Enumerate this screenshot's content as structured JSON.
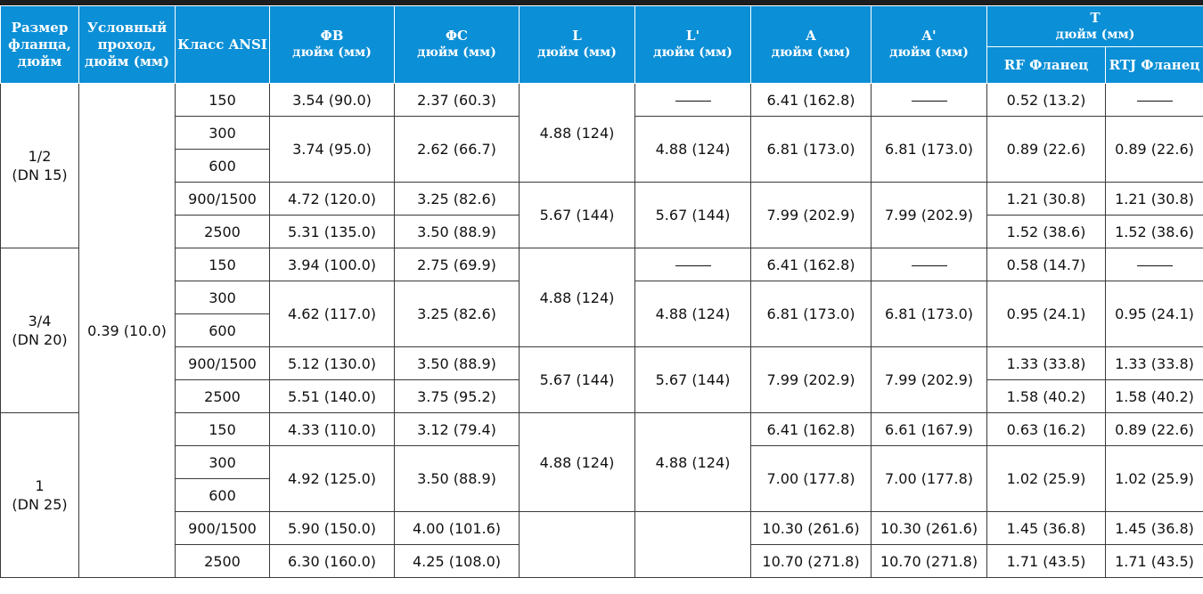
{
  "header": {
    "size": "Размер фланца, дюйм",
    "bore": "Условный проход, дюйм (мм)",
    "cls": "Класс ANSI",
    "fb": "ΦB",
    "fc": "ΦC",
    "l": "L",
    "l2": "L'",
    "a": "A",
    "a2": "A'",
    "t": "T",
    "unit": "дюйм (мм)",
    "rf": "RF Фланец",
    "rtj": "RTJ Фланец"
  },
  "dash": "—",
  "bore_value": "0.39 (10.0)",
  "groups": [
    {
      "size": "1/2",
      "dn": "(DN 15)",
      "rows": [
        {
          "cls": "150",
          "fb": "3.54 (90.0)",
          "fc": "2.37 (60.3)",
          "l2": "—",
          "a": "6.41 (162.8)",
          "a2": "—",
          "rf": "0.52 (13.2)",
          "rtj": "—"
        },
        {
          "cls": "300",
          "fb": "3.74 (95.0)",
          "fc": "2.62 (66.7)",
          "a": "6.81 (173.0)",
          "a2": "6.81 (173.0)",
          "rf": "0.89 (22.6)",
          "rtj": "0.89 (22.6)"
        },
        {
          "cls": "600"
        },
        {
          "cls": "900/1500",
          "fb": "4.72 (120.0)",
          "fc": "3.25 (82.6)",
          "rf": "1.21 (30.8)",
          "rtj": "1.21 (30.8)"
        },
        {
          "cls": "2500",
          "fb": "5.31 (135.0)",
          "fc": "3.50 (88.9)",
          "rf": "1.52 (38.6)",
          "rtj": "1.52 (38.6)"
        }
      ],
      "l_top": "4.88 (124)",
      "l2_mid": "4.88 (124)",
      "l_bot": "5.67 (144)",
      "l2_bot": "5.67 (144)",
      "a_bot": "7.99 (202.9)",
      "a2_bot": "7.99 (202.9)"
    },
    {
      "size": "3/4",
      "dn": "(DN 20)",
      "rows": [
        {
          "cls": "150",
          "fb": "3.94 (100.0)",
          "fc": "2.75 (69.9)",
          "l2": "—",
          "a": "6.41 (162.8)",
          "a2": "—",
          "rf": "0.58 (14.7)",
          "rtj": "—"
        },
        {
          "cls": "300",
          "fb": "4.62 (117.0)",
          "fc": "3.25 (82.6)",
          "a": "6.81 (173.0)",
          "a2": "6.81 (173.0)",
          "rf": "0.95 (24.1)",
          "rtj": "0.95 (24.1)"
        },
        {
          "cls": "600"
        },
        {
          "cls": "900/1500",
          "fb": "5.12 (130.0)",
          "fc": "3.50 (88.9)",
          "rf": "1.33 (33.8)",
          "rtj": "1.33 (33.8)"
        },
        {
          "cls": "2500",
          "fb": "5.51 (140.0)",
          "fc": "3.75 (95.2)",
          "rf": "1.58 (40.2)",
          "rtj": "1.58 (40.2)"
        }
      ],
      "l_top": "4.88 (124)",
      "l2_mid": "4.88 (124)",
      "l_bot": "5.67 (144)",
      "l2_bot": "5.67 (144)",
      "a_bot": "7.99 (202.9)",
      "a2_bot": "7.99 (202.9)"
    },
    {
      "size": "1",
      "dn": "(DN 25)",
      "rows": [
        {
          "cls": "150",
          "fb": "4.33 (110.0)",
          "fc": "3.12 (79.4)",
          "a": "6.41 (162.8)",
          "a2": "6.61 (167.9)",
          "rf": "0.63 (16.2)",
          "rtj": "0.89 (22.6)"
        },
        {
          "cls": "300",
          "fb": "4.92 (125.0)",
          "fc": "3.50 (88.9)",
          "a": "7.00 (177.8)",
          "a2": "7.00 (177.8)",
          "rf": "1.02 (25.9)",
          "rtj": "1.02 (25.9)"
        },
        {
          "cls": "600"
        },
        {
          "cls": "900/1500",
          "fb": "5.90 (150.0)",
          "fc": "4.00 (101.6)",
          "l": "",
          "l2": "",
          "a": "10.30 (261.6)",
          "a2": "10.30 (261.6)",
          "rf": "1.45 (36.8)",
          "rtj": "1.45 (36.8)"
        },
        {
          "cls": "2500",
          "fb": "6.30 (160.0)",
          "fc": "4.25 (108.0)",
          "a": "10.70 (271.8)",
          "a2": "10.70 (271.8)",
          "rf": "1.71 (43.5)",
          "rtj": "1.71 (43.5)"
        }
      ],
      "l_top": "4.88 (124)",
      "l2_top": "4.88 (124)"
    }
  ]
}
